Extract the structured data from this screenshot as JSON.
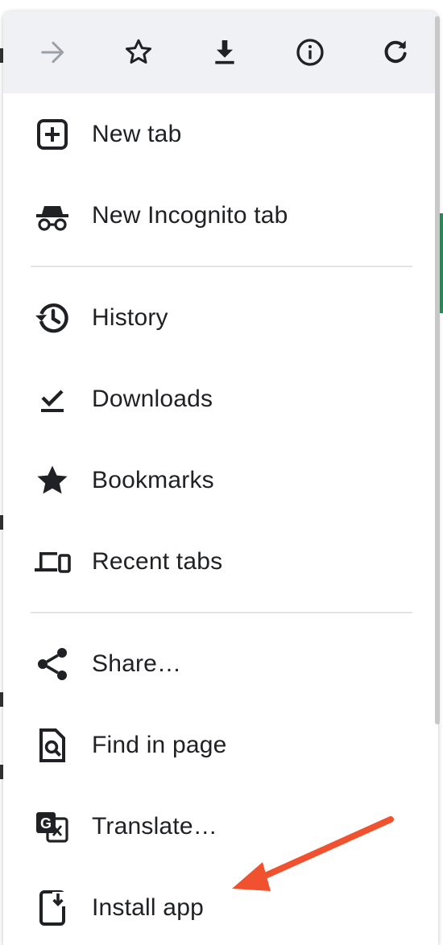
{
  "toolbar": {
    "buttons": [
      {
        "name": "forward",
        "icon": "arrow-right-icon",
        "enabled": false
      },
      {
        "name": "bookmark",
        "icon": "star-outline-icon",
        "enabled": true
      },
      {
        "name": "download",
        "icon": "download-icon",
        "enabled": true
      },
      {
        "name": "page-info",
        "icon": "info-icon",
        "enabled": true
      },
      {
        "name": "reload",
        "icon": "refresh-icon",
        "enabled": true
      }
    ]
  },
  "menu": {
    "group1": [
      {
        "label": "New tab",
        "icon": "plus-box-icon"
      },
      {
        "label": "New Incognito tab",
        "icon": "incognito-icon"
      }
    ],
    "group2": [
      {
        "label": "History",
        "icon": "history-icon"
      },
      {
        "label": "Downloads",
        "icon": "download-done-icon"
      },
      {
        "label": "Bookmarks",
        "icon": "star-icon"
      },
      {
        "label": "Recent tabs",
        "icon": "devices-icon"
      }
    ],
    "group3": [
      {
        "label": "Share…",
        "icon": "share-icon"
      },
      {
        "label": "Find in page",
        "icon": "find-in-page-icon"
      },
      {
        "label": "Translate…",
        "icon": "translate-icon"
      },
      {
        "label": "Install app",
        "icon": "install-app-icon"
      }
    ]
  },
  "colors": {
    "toolbar_bg": "#f0f1f5",
    "icon": "#202124",
    "icon_disabled": "#9aa0a6",
    "annotation_arrow": "#f0522f",
    "page_accent": "#2e8b57"
  }
}
